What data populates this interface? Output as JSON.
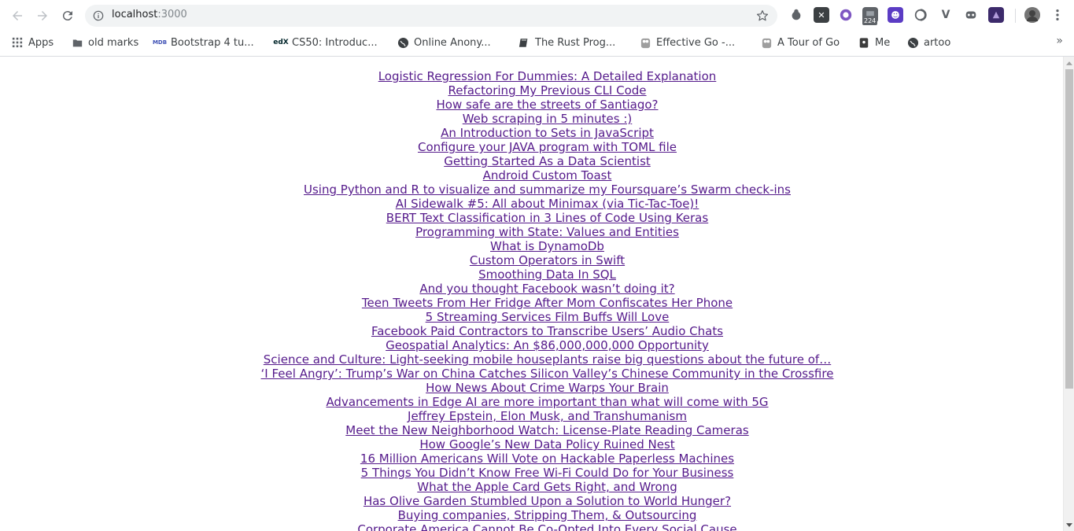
{
  "browser": {
    "url_host": "localhost",
    "url_port": ":3000",
    "extension_badge": "224"
  },
  "bookmarks": [
    {
      "label": "Apps",
      "icon": "apps-grid-icon"
    },
    {
      "label": "old marks",
      "icon": "folder-icon"
    },
    {
      "label": "Bootstrap 4 tu...",
      "icon": "mdb-icon"
    },
    {
      "label": "CS50: Introduc...",
      "icon": "edx-icon"
    },
    {
      "label": "Online Anony...",
      "icon": "globe-icon"
    },
    {
      "label": "The Rust Prog...",
      "icon": "book-icon"
    },
    {
      "label": "Effective Go -...",
      "icon": "gopher-icon"
    },
    {
      "label": "A Tour of Go",
      "icon": "gopher-icon"
    },
    {
      "label": "Me",
      "icon": "bookmark-dark-icon"
    },
    {
      "label": "artoo",
      "icon": "globe-icon"
    }
  ],
  "articles": [
    "Logistic Regression For Dummies: A Detailed Explanation",
    "Refactoring My Previous CLI Code",
    "How safe are the streets of Santiago?",
    "Web scraping in 5 minutes :)",
    "An Introduction to Sets in JavaScript",
    "Configure your JAVA program with TOML file",
    "Getting Started As a Data Scientist",
    "Android Custom Toast",
    "Using Python and R to visualize and summarize my Foursquare’s Swarm check-ins",
    "AI Sidewalk #5: All about Minimax (via Tic-Tac-Toe)!",
    "BERT Text Classification in 3 Lines of Code Using Keras",
    "Programming with State: Values and Entities",
    "What is DynamoDb",
    "Custom Operators in Swift",
    "Smoothing Data In SQL",
    "And you thought Facebook wasn’t doing it?",
    "Teen Tweets From Her Fridge After Mom Confiscates Her Phone",
    "5 Streaming Services Film Buffs Will Love",
    "Facebook Paid Contractors to Transcribe Users’ Audio Chats",
    "Geospatial Analytics: An $86,000,000,000 Opportunity",
    "Science and Culture: Light-seeking mobile houseplants raise big questions about the future of…",
    "‘I Feel Angry’: Trump’s War on China Catches Silicon Valley’s Chinese Community in the Crossfire",
    "How News About Crime Warps Your Brain",
    "Advancements in Edge AI are more important than what will come with 5G",
    "Jeffrey Epstein, Elon Musk, and Transhumanism",
    "Meet the New Neighborhood Watch: License-Plate Reading Cameras",
    "How Google’s New Data Policy Ruined Nest",
    "16 Million Americans Will Vote on Hackable Paperless Machines",
    "5 Things You Didn’t Know Free Wi-Fi Could Do for Your Business",
    "What the Apple Card Gets Right, and Wrong",
    "Has Olive Garden Stumbled Upon a Solution to World Hunger?",
    "Buying companies, Stripping Them, & Outsourcing",
    "Corporate America Cannot Be Co-Opted Into Every Social Cause"
  ],
  "colors": {
    "link_visited": "#551a8b",
    "chrome_bg": "#ffffff",
    "omnibox_bg": "#f1f3f4"
  }
}
